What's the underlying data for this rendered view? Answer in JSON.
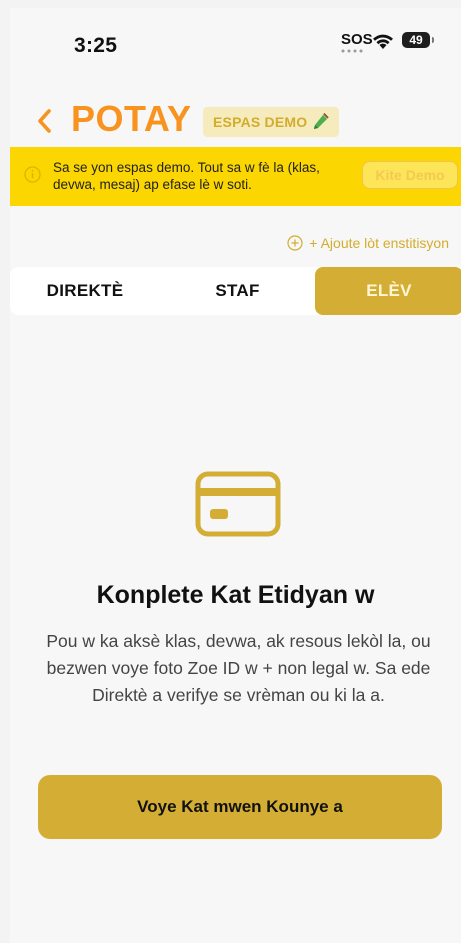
{
  "status_bar": {
    "time": "3:25",
    "sos": "SOS",
    "battery": "49"
  },
  "header": {
    "title": "POTAY",
    "badge": "ESPAS DEMO"
  },
  "banner": {
    "message": "Sa se yon espas demo. Tout sa w fè la (klas, devwa, mesaj) ap efase lè w soti.",
    "exit_button": "Kite Demo"
  },
  "add_institution": {
    "label": "+ Ajoute lòt enstitisyon"
  },
  "tabs": [
    {
      "label": "DIREKTÈ",
      "active": false
    },
    {
      "label": "STAF",
      "active": false
    },
    {
      "label": "ELÈV",
      "active": true
    }
  ],
  "content": {
    "title": "Konplete Kat Etidyan w",
    "body": "Pou w ka aksè klas, devwa, ak resous lekòl la, ou bezwen voye foto Zoe ID w + non legal w. Sa ede Direktè a verifye se vrèman ou ki la a.",
    "button": "Voye Kat mwen Kounye a"
  },
  "colors": {
    "brand_orange": "#f7931e",
    "accent_gold": "#d4ae34",
    "banner_yellow": "#fcd600"
  },
  "icons": {
    "back": "chevron-left-icon",
    "badge": "flask-icon",
    "info": "info-icon",
    "add": "plus-circle-icon",
    "card": "id-card-icon"
  }
}
